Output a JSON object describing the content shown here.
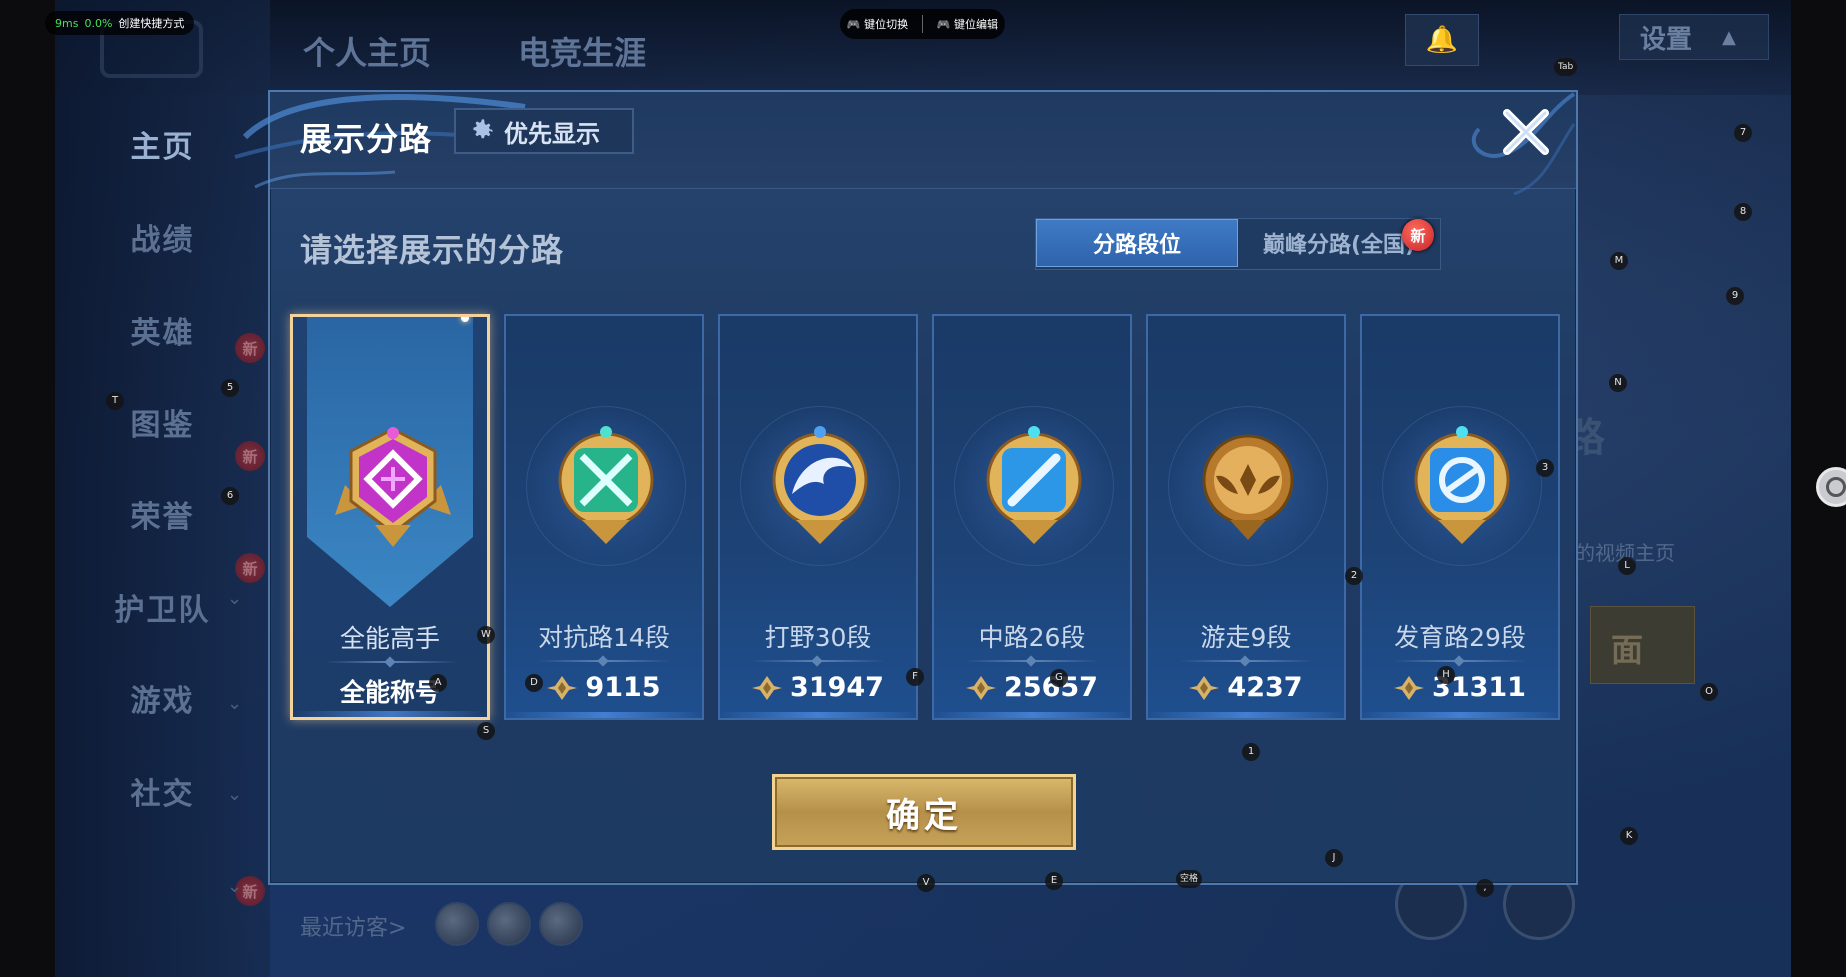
{
  "overlay": {
    "perf_ms": "9ms",
    "perf_pct": "0.0%",
    "shortcut_label": "创建快捷方式",
    "key_switch": "键位切换",
    "key_edit": "键位编辑",
    "markers": [
      "Tab",
      "7",
      "8",
      "M",
      "9",
      "N",
      "3",
      "L",
      "O",
      "K",
      "T",
      "5",
      "6",
      "W",
      "A",
      "S",
      "D",
      "F",
      "G",
      "H",
      "2",
      "1",
      "J",
      "V",
      "E",
      "空格",
      ","
    ]
  },
  "background": {
    "tabs": [
      "个人主页",
      "电竞生涯"
    ],
    "settings_label": "设置",
    "sidebar": [
      {
        "label": "主页",
        "active": true,
        "has_new": false
      },
      {
        "label": "战绩",
        "active": false,
        "has_new": false
      },
      {
        "label": "英雄",
        "active": false,
        "has_new": true
      },
      {
        "label": "图鉴",
        "active": false,
        "has_new": true
      },
      {
        "label": "荣誉",
        "active": false,
        "has_new": true
      },
      {
        "label": "护卫队",
        "active": false,
        "has_new": false
      },
      {
        "label": "游戏",
        "active": false,
        "has_new": false
      },
      {
        "label": "社交",
        "active": false,
        "has_new": true
      }
    ],
    "new_badge": "新",
    "visitors_label": "最近访客>",
    "right_text": "的视频主页",
    "right_btn_text": "面",
    "right_big_text": "路"
  },
  "modal": {
    "title": "展示分路",
    "priority_button": "优先显示",
    "subtitle": "请选择展示的分路",
    "segment_tabs": [
      {
        "label": "分路段位",
        "active": true,
        "new": false
      },
      {
        "label": "巅峰分路(全国)",
        "active": false,
        "new": true
      }
    ],
    "new_badge": "新",
    "confirm_label": "确定",
    "cards": [
      {
        "name": "全能高手",
        "value": "全能称号",
        "selected": true,
        "emblem": "all-round-emblem",
        "color": "#c234c8",
        "has_score_icon": false
      },
      {
        "name": "对抗路14段",
        "value": "9115",
        "selected": false,
        "emblem": "clash-lane-emblem",
        "color": "#27b48a",
        "has_score_icon": true
      },
      {
        "name": "打野30段",
        "value": "31947",
        "selected": false,
        "emblem": "jungle-emblem",
        "color": "#2f6fd1",
        "has_score_icon": true
      },
      {
        "name": "中路26段",
        "value": "25657",
        "selected": false,
        "emblem": "mid-lane-emblem",
        "color": "#2b97e6",
        "has_score_icon": true
      },
      {
        "name": "游走9段",
        "value": "4237",
        "selected": false,
        "emblem": "roam-emblem",
        "color": "#c88a3a",
        "has_score_icon": true
      },
      {
        "name": "发育路29段",
        "value": "31311",
        "selected": false,
        "emblem": "farm-lane-emblem",
        "color": "#2a8ee8",
        "has_score_icon": true
      }
    ]
  }
}
